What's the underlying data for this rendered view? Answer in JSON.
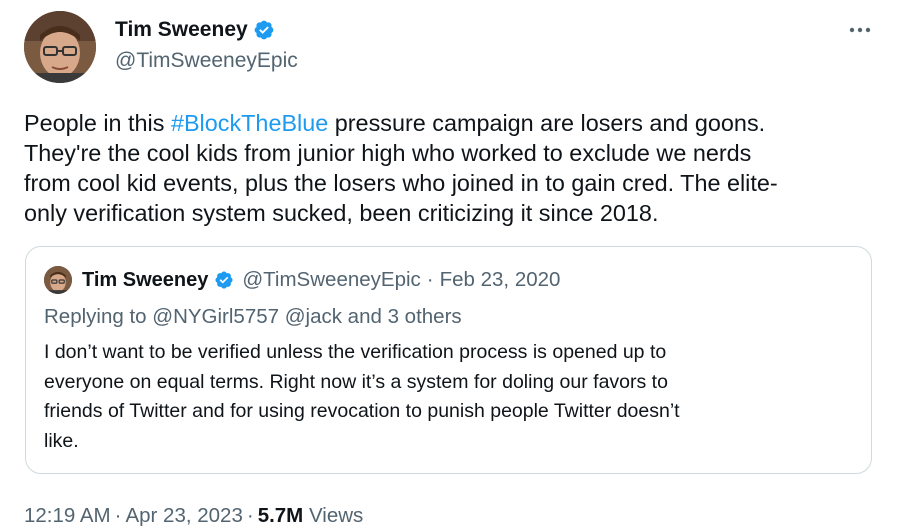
{
  "author": {
    "name": "Tim Sweeney",
    "handle": "@TimSweeneyEpic",
    "verified": true
  },
  "tweet": {
    "lines": [
      {
        "before": "People in this ",
        "hashtag": "#BlockTheBlue",
        "after": " pressure campaign are losers and goons."
      },
      {
        "text": "They're the cool kids from junior high who worked to exclude we nerds"
      },
      {
        "text": "from cool kid events, plus the losers who joined in to gain cred. The elite-"
      },
      {
        "text": "only verification system sucked, been criticizing it since 2018."
      }
    ]
  },
  "quoted_tweet": {
    "author_name": "Tim Sweeney",
    "author_handle": "@TimSweeneyEpic",
    "separator": "·",
    "date": "Feb 23, 2020",
    "replying_to": "Replying to @NYGirl5757 @jack and 3 others",
    "lines": [
      "I don’t want to be verified unless the verification process is opened up to",
      "everyone on equal terms. Right now it’s a system for doling our favors to",
      "friends of Twitter and for using revocation to punish people Twitter doesn’t",
      "like."
    ]
  },
  "meta": {
    "time": "12:19 AM",
    "separator": "·",
    "date": "Apr 23, 2023",
    "views_count": "5.7M",
    "views_label": "Views"
  },
  "colors": {
    "text": "#0f1419",
    "secondary": "#536471",
    "link": "#1d9bf0",
    "border": "#cfd9de",
    "verified": "#1d9bf0"
  },
  "icons": {
    "more": "more-dots-icon",
    "verified": "verified-badge-icon"
  }
}
